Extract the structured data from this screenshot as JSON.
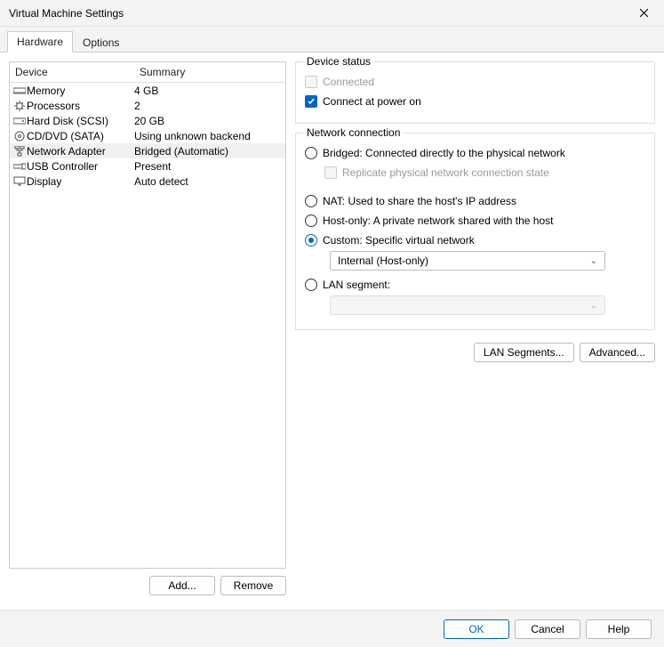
{
  "window": {
    "title": "Virtual Machine Settings"
  },
  "tabs": {
    "hardware": "Hardware",
    "options": "Options"
  },
  "device_table": {
    "headers": {
      "device": "Device",
      "summary": "Summary"
    },
    "rows": [
      {
        "icon": "memory-icon",
        "device": "Memory",
        "summary": "4 GB"
      },
      {
        "icon": "cpu-icon",
        "device": "Processors",
        "summary": "2"
      },
      {
        "icon": "disk-icon",
        "device": "Hard Disk (SCSI)",
        "summary": "20 GB"
      },
      {
        "icon": "cd-icon",
        "device": "CD/DVD (SATA)",
        "summary": "Using unknown backend"
      },
      {
        "icon": "network-icon",
        "device": "Network Adapter",
        "summary": "Bridged (Automatic)"
      },
      {
        "icon": "usb-icon",
        "device": "USB Controller",
        "summary": "Present"
      },
      {
        "icon": "display-icon",
        "device": "Display",
        "summary": "Auto detect"
      }
    ]
  },
  "left_buttons": {
    "add": "Add...",
    "remove": "Remove"
  },
  "device_status": {
    "legend": "Device status",
    "connected": "Connected",
    "connect_at_power_on": "Connect at power on"
  },
  "network_connection": {
    "legend": "Network connection",
    "bridged": "Bridged: Connected directly to the physical network",
    "replicate": "Replicate physical network connection state",
    "nat": "NAT: Used to share the host's IP address",
    "hostonly": "Host-only: A private network shared with the host",
    "custom": "Custom: Specific virtual network",
    "custom_value": "Internal (Host-only)",
    "lan_segment": "LAN segment:"
  },
  "right_buttons": {
    "lan_segments": "LAN Segments...",
    "advanced": "Advanced..."
  },
  "footer": {
    "ok": "OK",
    "cancel": "Cancel",
    "help": "Help"
  }
}
